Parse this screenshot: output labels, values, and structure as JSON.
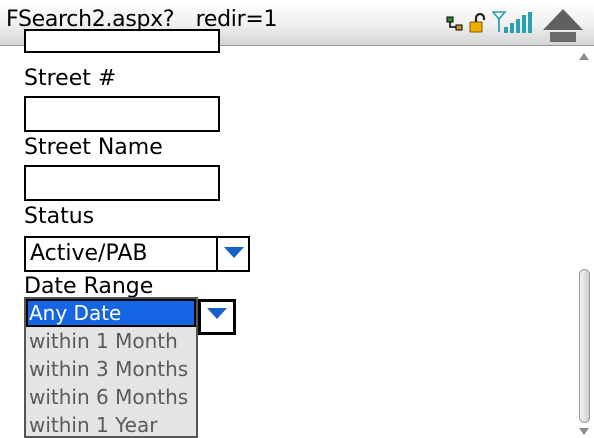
{
  "window": {
    "title": "FSearch2.aspx?__redir=1"
  },
  "status_icons": [
    "network-icon",
    "lock-icon",
    "signal-strength-icon",
    "scroll-up-icon"
  ],
  "form": {
    "street_number_label": "Street #",
    "street_number_value": "",
    "street_name_label": "Street Name",
    "street_name_value": "",
    "status_label": "Status",
    "status_selected": "Active/PAB",
    "date_range_label": "Date Range",
    "date_range_selected": "Any Date",
    "date_range_options": [
      "Any Date",
      "within 1 Month",
      "within 3 Months",
      "within 6 Months",
      "within 1 Year"
    ]
  },
  "colors": {
    "accent": "#1565e4",
    "arrow": "#1560c9"
  }
}
